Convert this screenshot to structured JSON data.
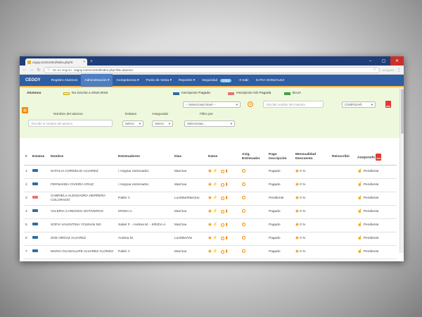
{
  "browser": {
    "tab_title": "cegoy.com/control/index.php?it",
    "tab_close": "×",
    "new_tab": "+",
    "security": "No es seguro",
    "url": "cegoy.com/control/index.php?list=alumno",
    "incognito": "Incógnito",
    "win_min": "–",
    "win_max": "▢",
    "win_close": "✕"
  },
  "menu": {
    "brand": "CEGOY",
    "items": [
      {
        "label": "Registro Alumnos",
        "active": false
      },
      {
        "label": "Administración ▾",
        "active": true
      },
      {
        "label": "Competencia ▾",
        "active": false
      },
      {
        "label": "Punto de Venta ▾",
        "active": false
      },
      {
        "label": "Reportes ▾",
        "active": false
      },
      {
        "label": "Seguridad",
        "active": false
      }
    ],
    "badge": "1762",
    "salir": "⇥ Salir",
    "user": "KATIA GONZALEZ"
  },
  "legend": {
    "section": "Alumnos",
    "no_inscrito": "No inscrito a 2018-2019.",
    "pagada": "Inscripcion Pagada",
    "no_pagada": "Inscripcion NO Pagada",
    "baja": "BAJA",
    "colors": {
      "no_inscrito": "#ffe566",
      "pagada": "#2e6da4",
      "no_pagada": "#e57373",
      "baja": "#43a047"
    }
  },
  "filters": {
    "nivel": "-- Seleccionar Nivel --",
    "maestro_placeholder": "Escribir nombre del maestro",
    "cumple": "CUMPLEAÑ",
    "nombre_label": "Nombre del alumno",
    "nombre_placeholder": "Escribe el nombre del alumno",
    "estatus_label": "Estatus",
    "estatus_value": "Selecc",
    "asegurado_label": "Asegurado",
    "asegurado_value": "Selecc",
    "filtro_label": "Filtro por",
    "filtro_value": "Seleccionar..."
  },
  "table": {
    "headers": [
      "#",
      "Estatus",
      "Nombre",
      "Entrenadores",
      "Dias",
      "Datos",
      "Asig. Entrenador",
      "Pago Inscripción",
      "Mensualidad Descuento",
      "Reinscribir",
      "Asegurado"
    ],
    "rows": [
      {
        "n": "1",
        "status": "#2e6da4",
        "name": "NATALIA CORNELIO ALVAREZ",
        "ent": "/ Asignar entrenador.",
        "dias": "Mar/Jue",
        "pago": "Pagado",
        "desc": "0 %",
        "aseg": "Pendiente"
      },
      {
        "n": "2",
        "status": "#2e6da4",
        "name": "FERNANDA CIVEIRA CRUZ",
        "ent": "/ Asignar entrenador.",
        "dias": "Mar/Jue",
        "pago": "Pagado",
        "desc": "0 %",
        "aseg": "Pendiente"
      },
      {
        "n": "3",
        "status": "#e57373",
        "name": "GABRIELA ALESSADRA HERRERA COLORADO",
        "ent": "Pablo Y.",
        "dias": "Lun/Mar/Mie/Jue",
        "pago": "Pendiente",
        "desc": "0 %",
        "aseg": "Pendiente"
      },
      {
        "n": "4",
        "status": "#2e6da4",
        "name": "VALERIA CARDOSO ONTIVEROS",
        "ent": "KRIZIA A.",
        "dias": "Mar/Jue",
        "pago": "Pagado",
        "desc": "0 %",
        "aseg": "Pendiente"
      },
      {
        "n": "5",
        "status": "#2e6da4",
        "name": "SOFIA VALENTINA YOUNAN NO",
        "ent": "Sabel F. - Andrea M. - KRIZIA A.",
        "dias": "Mar/Jue",
        "pago": "Pagado",
        "desc": "0 %",
        "aseg": "Pendiente"
      },
      {
        "n": "6",
        "status": "#2e6da4",
        "name": "ZOE ORDAZ ALVAREZ",
        "ent": "Andrea M.",
        "dias": "Lun/Mie/Vie",
        "pago": "Pagado",
        "desc": "0 %",
        "aseg": "Pendiente"
      },
      {
        "n": "7",
        "status": "#2e6da4",
        "name": "MARIA GUADALUPE ALVAREZ ALONSO",
        "ent": "Pablo Y.",
        "dias": "Mar/Jue",
        "pago": "Pagado",
        "desc": "0 %",
        "aseg": "Pendiente"
      }
    ]
  }
}
